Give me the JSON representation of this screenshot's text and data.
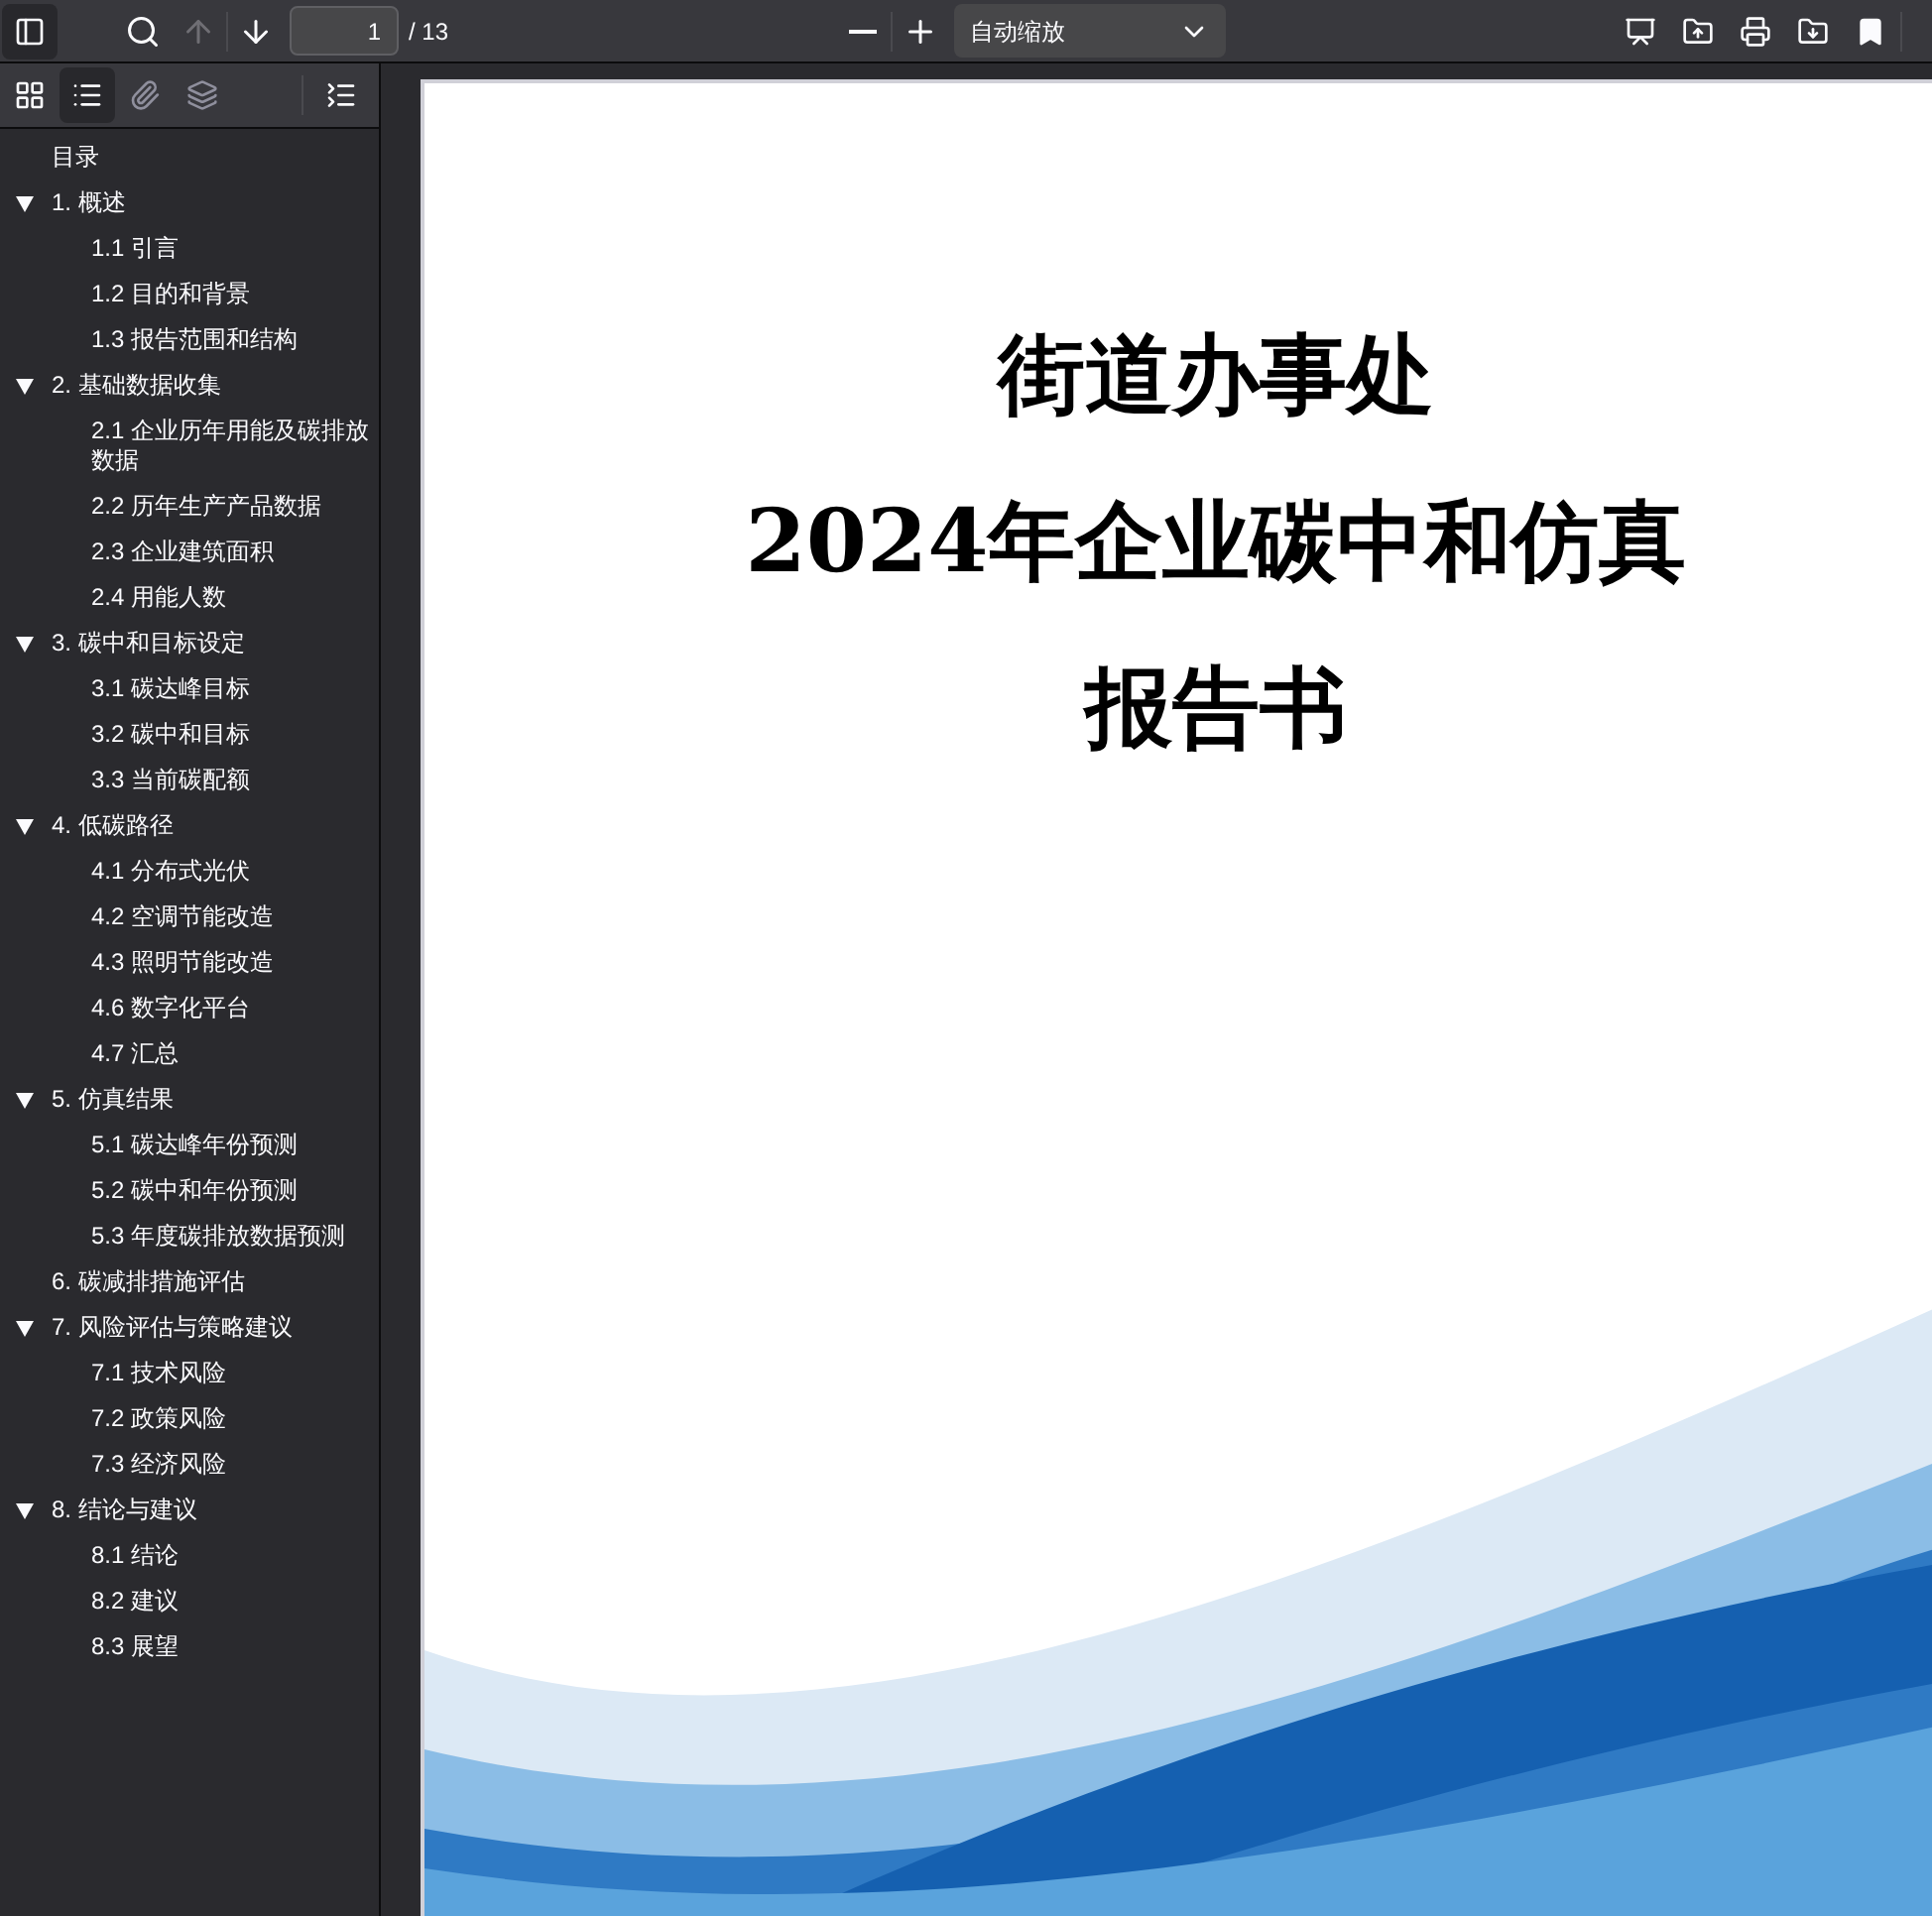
{
  "toolbar": {
    "sidebar_toggle": {
      "selected": true
    },
    "find": {
      "disabled": false
    },
    "previous_page": {
      "disabled": true
    },
    "next_page": {
      "disabled": false
    },
    "page_number": {
      "value": "1"
    },
    "page_count": "/ 13",
    "zoom_select": {
      "value": "自动缩放"
    }
  },
  "sidebar_tabs": [
    {
      "kind": "thumbnails",
      "selected": false,
      "disabled": false
    },
    {
      "kind": "outline",
      "selected": true,
      "disabled": false
    },
    {
      "kind": "attachments",
      "selected": false,
      "disabled": true
    },
    {
      "kind": "layers",
      "selected": false,
      "disabled": true
    }
  ],
  "outline": [
    {
      "label": "目录"
    },
    {
      "label": "1. 概述",
      "expanded": true,
      "children": [
        {
          "label": "1.1 引言"
        },
        {
          "label": "1.2 目的和背景"
        },
        {
          "label": "1.3 报告范围和结构"
        }
      ]
    },
    {
      "label": "2. 基础数据收集",
      "expanded": true,
      "children": [
        {
          "label": "2.1 企业历年用能及碳排放数据"
        },
        {
          "label": "2.2 历年生产产品数据"
        },
        {
          "label": "2.3 企业建筑面积"
        },
        {
          "label": "2.4 用能人数"
        }
      ]
    },
    {
      "label": "3. 碳中和目标设定",
      "expanded": true,
      "children": [
        {
          "label": "3.1 碳达峰目标"
        },
        {
          "label": "3.2 碳中和目标"
        },
        {
          "label": "3.3 当前碳配额"
        }
      ]
    },
    {
      "label": "4. 低碳路径",
      "expanded": true,
      "children": [
        {
          "label": "4.1 分布式光伏"
        },
        {
          "label": "4.2 空调节能改造"
        },
        {
          "label": "4.3 照明节能改造"
        },
        {
          "label": "4.6 数字化平台"
        },
        {
          "label": "4.7 汇总"
        }
      ]
    },
    {
      "label": "5. 仿真结果",
      "expanded": true,
      "children": [
        {
          "label": "5.1 碳达峰年份预测"
        },
        {
          "label": "5.2 碳中和年份预测"
        },
        {
          "label": "5.3 年度碳排放数据预测"
        }
      ]
    },
    {
      "label": "6. 碳减排措施评估"
    },
    {
      "label": "7. 风险评估与策略建议",
      "expanded": true,
      "children": [
        {
          "label": "7.1 技术风险"
        },
        {
          "label": "7.2 政策风险"
        },
        {
          "label": "7.3 经济风险"
        }
      ]
    },
    {
      "label": "8. 结论与建议",
      "expanded": true,
      "children": [
        {
          "label": "8.1 结论"
        },
        {
          "label": "8.2 建议"
        },
        {
          "label": "8.3 展望"
        }
      ]
    }
  ],
  "page": {
    "title_lines": [
      "街道办事处",
      "2024年企业碳中和仿真",
      "报告书"
    ]
  }
}
